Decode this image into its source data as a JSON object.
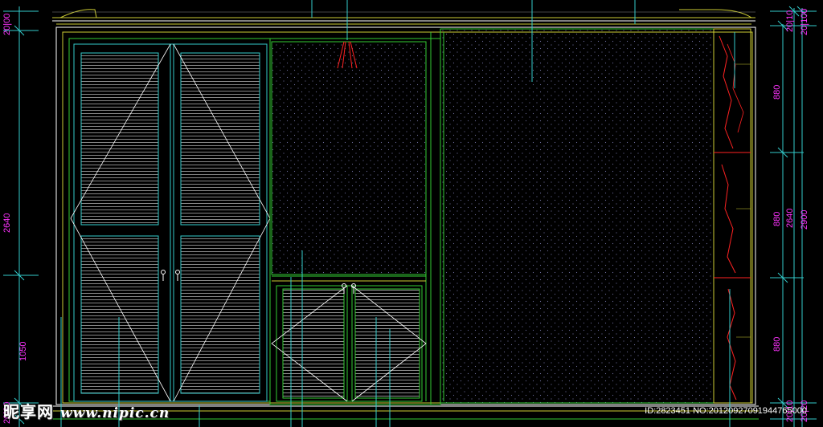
{
  "dimensions_left": {
    "top": "20|00",
    "total": "2640",
    "lower": "1050",
    "bottom": "20|20"
  },
  "dimensions_right_inner": {
    "top": "20|10",
    "seg1": "880",
    "seg2": "880",
    "seg3": "880",
    "total": "2640",
    "bottom": "20|10"
  },
  "dimensions_right_outer": {
    "top": "20|100",
    "total": "2900",
    "bottom": "20|20"
  },
  "watermark": {
    "brand": "昵享网",
    "url": "www.nipic.cn",
    "id_line": "ID:2823451 NO:20120927091944765000"
  },
  "colors": {
    "frame": "#ffffff",
    "green": "#33cc33",
    "cyan": "#33cccc",
    "yellow": "#cccc33",
    "magenta": "#ff33ff",
    "red": "#ff2222"
  }
}
